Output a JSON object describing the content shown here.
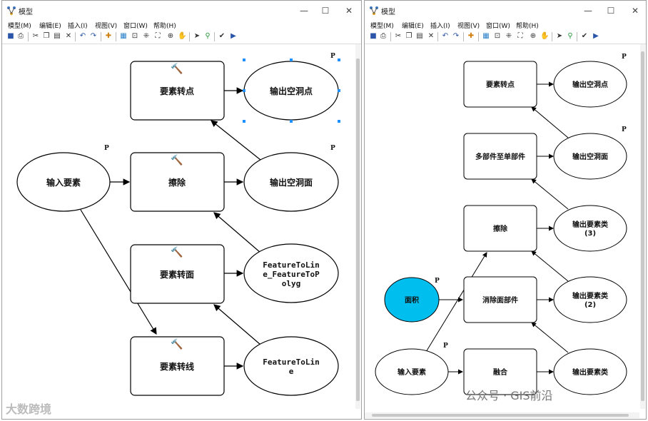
{
  "window_title": "模型",
  "menus": [
    "模型(M)",
    "编辑(E)",
    "插入(I)",
    "视图(V)",
    "窗口(W)",
    "帮助(H)"
  ],
  "window_buttons": {
    "minimize": "—",
    "maximize": "☐",
    "close": "✕"
  },
  "left_model": {
    "nodes": {
      "input": "输入要素",
      "tool_points": "要素转点",
      "tool_erase": "擦除",
      "tool_polygon": "要素转面",
      "tool_line": "要素转线",
      "out_points": "输出空洞点",
      "out_polygon": "输出空洞面",
      "ftp_line1": "FeatureToLin",
      "ftp_line2": "e_FeatureToP",
      "ftp_line3": "olyg",
      "ftl_line1": "FeatureToLin",
      "ftl_line2": "e"
    },
    "param_marker": "P"
  },
  "right_model": {
    "nodes": {
      "tool_points": "要素转点",
      "out_points": "输出空洞点",
      "tool_multipart": "多部件至单部件",
      "out_polygon": "输出空洞面",
      "tool_erase": "擦除",
      "out3_line1": "输出要素类",
      "out3_line2": "(3)",
      "area": "面积",
      "tool_eliminate": "消除面部件",
      "out2_line1": "输出要素类",
      "out2_line2": "(2)",
      "input": "输入要素",
      "tool_dissolve": "融合",
      "out1": "输出要素类"
    },
    "param_marker": "P",
    "area_color": "#00bfef"
  },
  "watermarks": {
    "left": "大数跨境",
    "right": "公众号 · GIS前沿"
  }
}
